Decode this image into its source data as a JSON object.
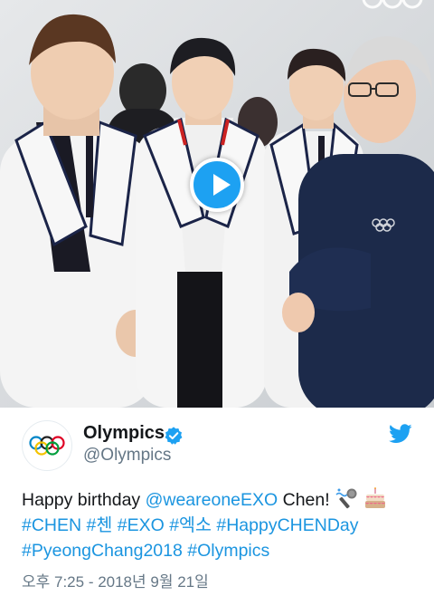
{
  "tweet": {
    "display_name": "Olympics",
    "handle": "@Olympics",
    "text_intro": "Happy birthday ",
    "mention": "@weareoneEXO",
    "text_after_mention": " Chen! ",
    "hashtags_line1": [
      "#CHEN",
      "#첸",
      "#EXO",
      "#엑소",
      "#HappyCHENDay"
    ],
    "hashtags_line2": [
      "#PyeongChang2018",
      "#Olympics"
    ],
    "emojis": [
      "microphone-emoji",
      "birthday-cake-emoji"
    ],
    "timestamp": "오후 7:25 - 2018년 9월 21일"
  },
  "media": {
    "type": "video",
    "play_icon": "play-icon"
  },
  "colors": {
    "link": "#1b95e0",
    "twitter_blue": "#1da1f2",
    "text": "#14171a",
    "secondary": "#657786"
  }
}
